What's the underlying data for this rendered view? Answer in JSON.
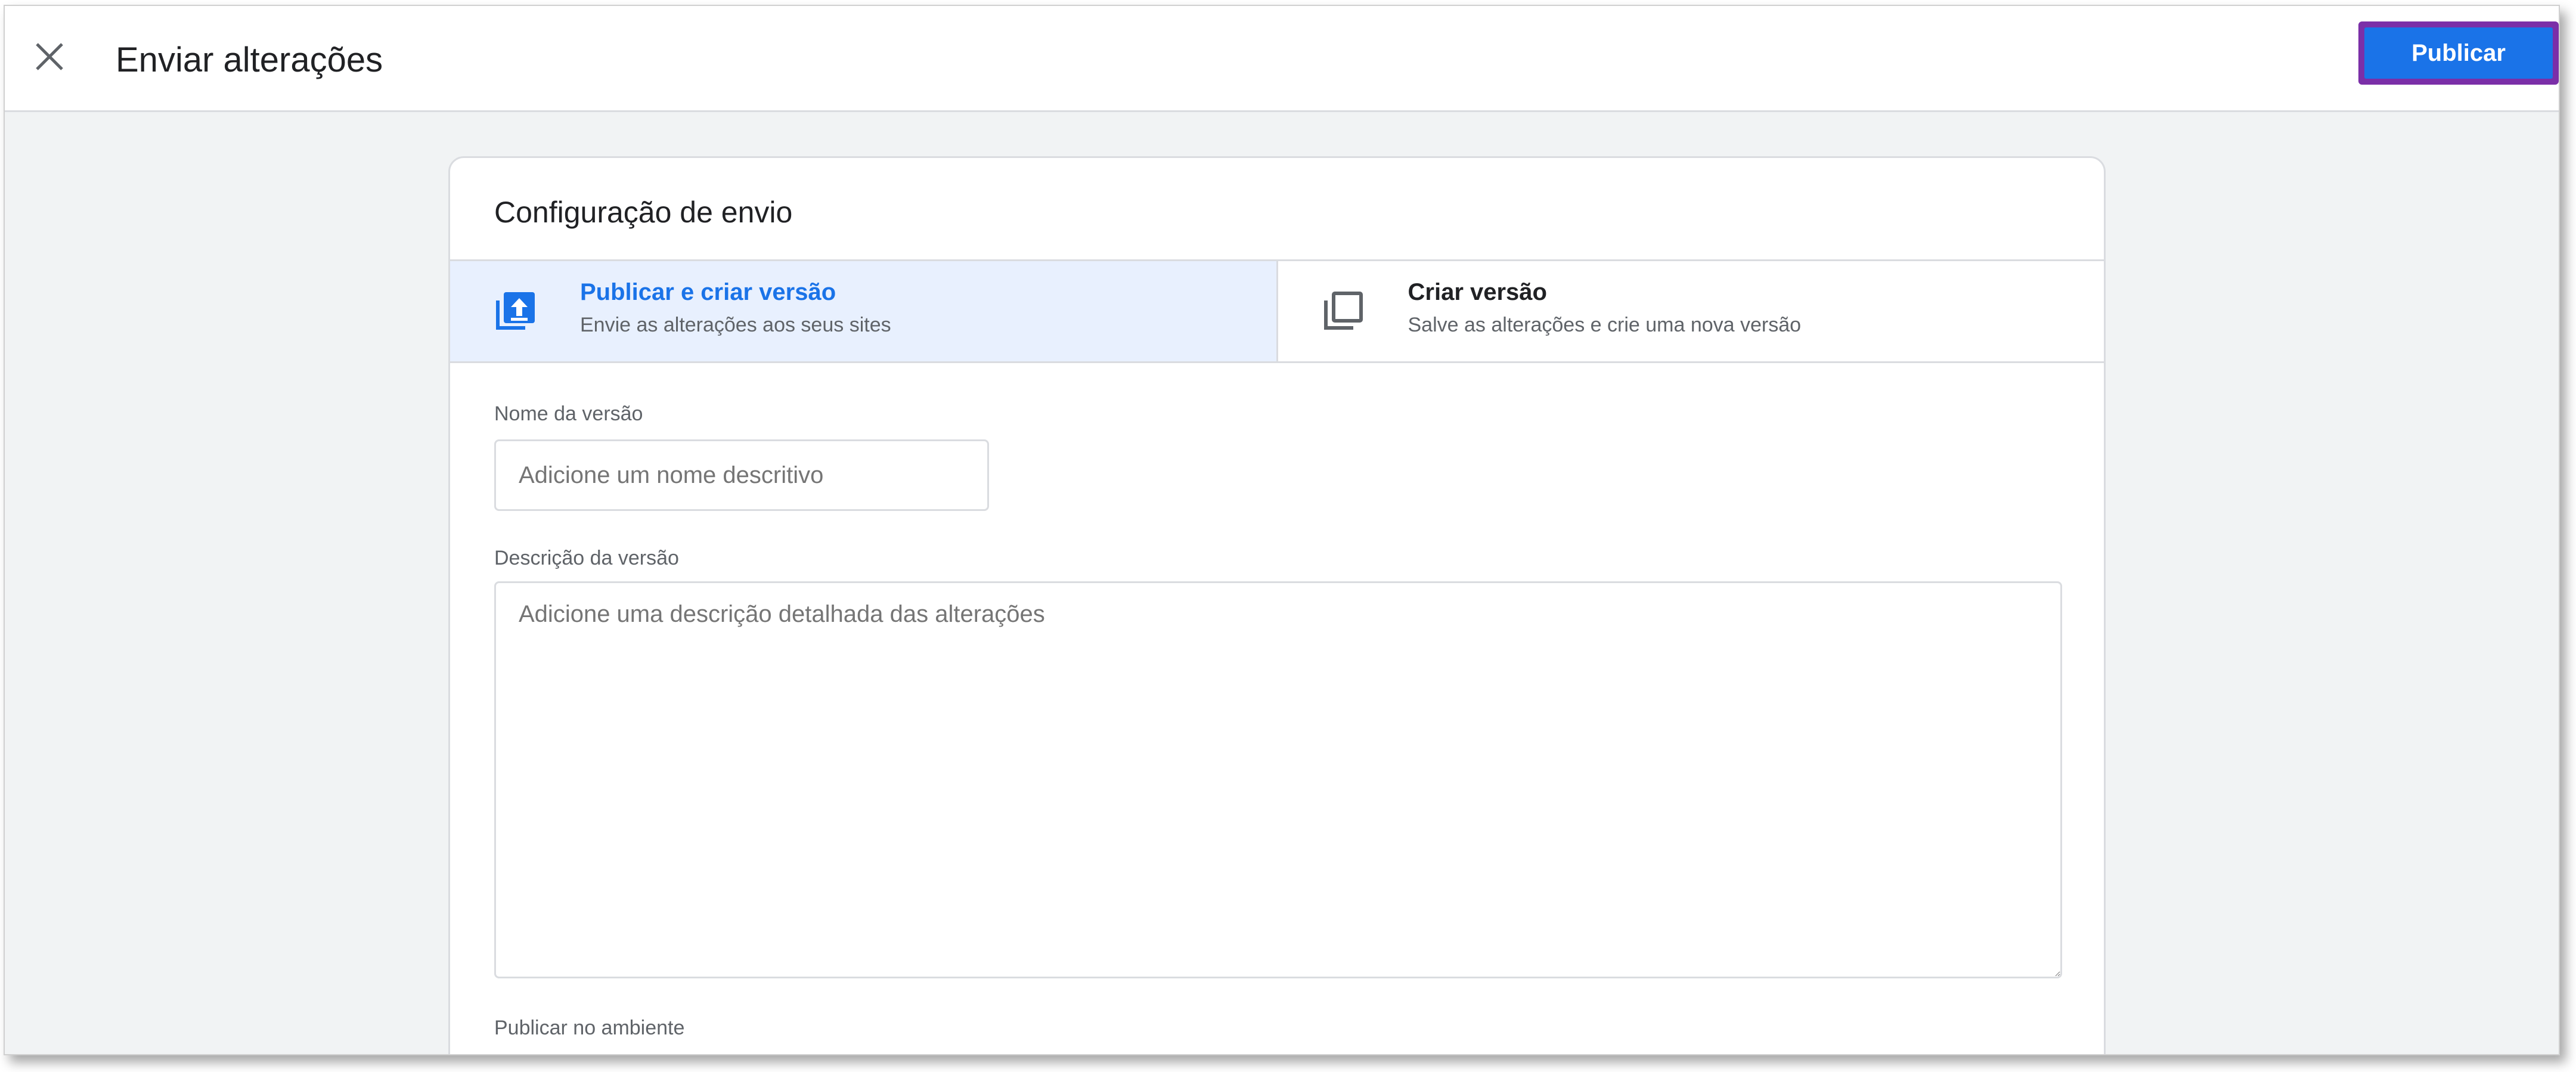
{
  "header": {
    "title": "Enviar alterações",
    "close_icon": "close-icon",
    "publish_label": "Publicar"
  },
  "card": {
    "title": "Configuração de envio",
    "options": [
      {
        "title": "Publicar e criar versão",
        "subtitle": "Envie as alterações aos seus sites",
        "icon": "publish-upload-icon",
        "selected": true
      },
      {
        "title": "Criar versão",
        "subtitle": "Salve as alterações e crie uma nova versão",
        "icon": "copy-version-icon",
        "selected": false
      }
    ],
    "version_name": {
      "label": "Nome da versão",
      "placeholder": "Adicione um nome descritivo",
      "value": ""
    },
    "version_description": {
      "label": "Descrição da versão",
      "placeholder": "Adicione uma descrição detalhada das alterações",
      "value": ""
    },
    "environment": {
      "label": "Publicar no ambiente"
    }
  },
  "colors": {
    "accent": "#1a73e8",
    "selected_bg": "#e8f0fe",
    "highlight_border": "#7b2fa8",
    "page_bg": "#f1f3f4"
  }
}
